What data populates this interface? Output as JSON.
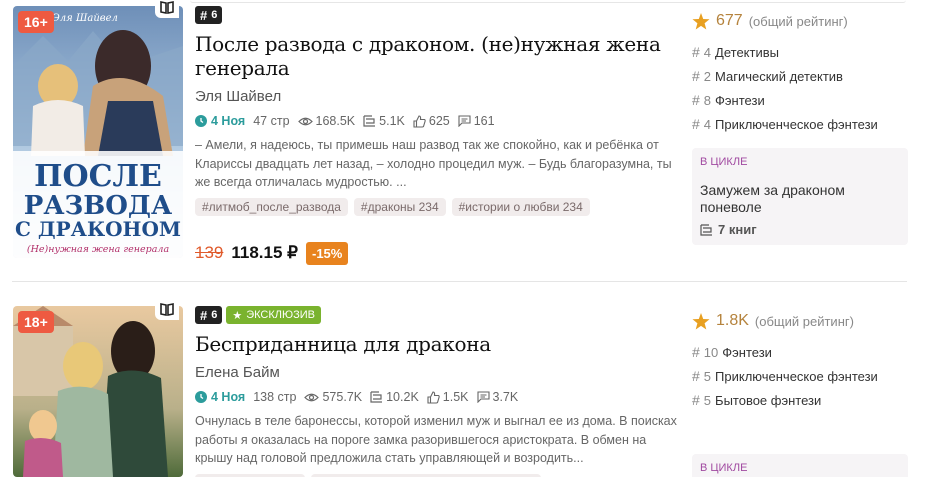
{
  "books": [
    {
      "age": "16+",
      "rank": "6",
      "title": "После развода с драконом. (не)нужная жена генерала",
      "author": "Эля Шайвел",
      "date": "4 Ноя",
      "pages": "47 стр",
      "views": "168.5K",
      "library": "5.1K",
      "likes": "625",
      "comments": "161",
      "description": "– Амели, я надеюсь, ты примешь наш развод так же спокойно, как и ребёнка от Клариссы двадцать лет назад, – холодно процедил муж. – Будь благоразумна, ты же всегда отличалась мудростью. ...",
      "tags": [
        "#литмоб_после_развода",
        "#драконы 234",
        "#истории о любви 234"
      ],
      "old_price": "139",
      "new_price": "118.15 ₽",
      "discount": "-15%",
      "rating": "677",
      "rating_note": "(общий рейтинг)",
      "genres": [
        {
          "count": "4",
          "name": "Детективы"
        },
        {
          "count": "2",
          "name": "Магический детектив"
        },
        {
          "count": "8",
          "name": "Фэнтези"
        },
        {
          "count": "4",
          "name": "Приключенческое фэнтези"
        }
      ],
      "cycle_label": "В цикле",
      "cycle_title": "Замужем за драконом поневоле",
      "cycle_books": "7 книг",
      "cover_text": [
        "ПОСЛЕ",
        "РАЗВОДА",
        "С ДРАКОНОМ",
        "(Не)нужная жена генерала"
      ],
      "cover_author": "Эля Шайвел"
    },
    {
      "age": "18+",
      "rank": "6",
      "exclusive": "ЭКСКЛЮЗИВ",
      "title": "Бесприданница для дракона",
      "author": "Елена Байм",
      "date": "4 Ноя",
      "pages": "138 стр",
      "views": "575.7K",
      "library": "10.2K",
      "likes": "1.5K",
      "comments": "3.7K",
      "description": "Очнулась в теле баронессы, которой изменил муж и выгнал ее из дома. В поисках работы я оказалась на пороге замка разорившегося аристократа. В обмен на крышу над головой предложила стать управляющей и возродить...",
      "rating": "1.8K",
      "rating_note": "(общий рейтинг)",
      "genres": [
        {
          "count": "10",
          "name": "Фэнтези"
        },
        {
          "count": "5",
          "name": "Приключенческое фэнтези"
        },
        {
          "count": "5",
          "name": "Бытовое фэнтези"
        }
      ],
      "cycle_label": "В цикле"
    }
  ],
  "colors": {
    "accent_teal": "#2c9c9c",
    "price_red": "#e05a2b",
    "discount_orange": "#e8831e",
    "star": "#e8a021",
    "exclusive_green": "#7ab32e",
    "age_badge": "#ee5a41",
    "cycle_purple": "#a14aa1"
  }
}
